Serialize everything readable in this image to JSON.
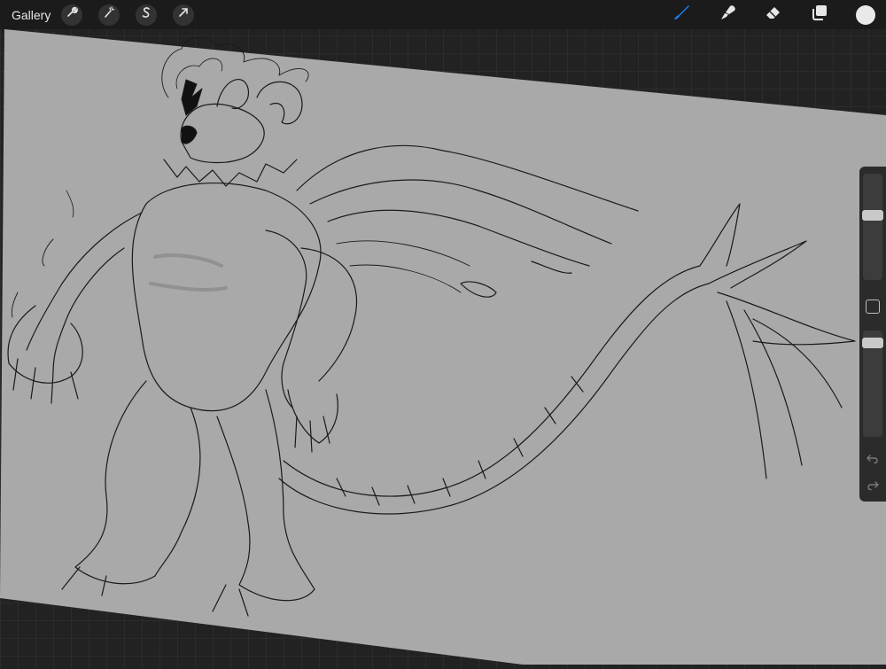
{
  "topbar": {
    "gallery_label": "Gallery",
    "left_tools": [
      {
        "name": "wrench-icon"
      },
      {
        "name": "magic-wand-icon"
      },
      {
        "name": "selection-s-icon"
      },
      {
        "name": "transform-arrow-icon"
      }
    ],
    "right_tools": [
      {
        "name": "brush-icon",
        "active": true
      },
      {
        "name": "smudge-icon"
      },
      {
        "name": "eraser-icon"
      },
      {
        "name": "layers-icon"
      },
      {
        "name": "color-swatch-icon"
      }
    ]
  },
  "sidebar": {
    "brush_size_level": 0.38,
    "opacity_level": 0.07
  },
  "colors": {
    "accent": "#1e7cf2",
    "canvas": "#a9a9a9",
    "background": "#222222",
    "topbar": "#1b1b1b",
    "current_color": "#e9e9e9"
  }
}
